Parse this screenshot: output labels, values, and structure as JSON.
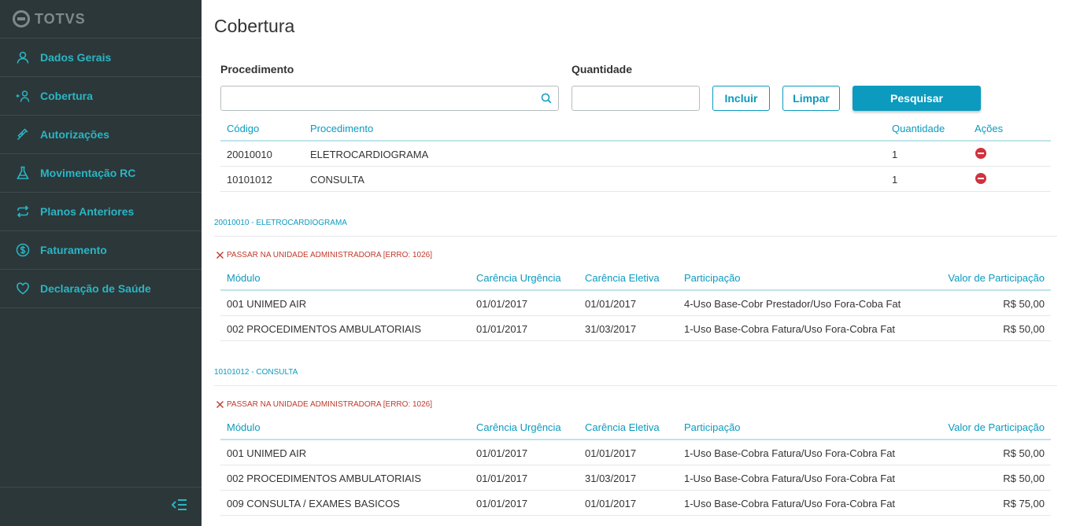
{
  "brand": {
    "name": "TOTVS",
    "accent": "#0c9abe",
    "sidebar_bg": "#2c3739",
    "error_color": "#c0392b"
  },
  "sidebar": {
    "items": [
      {
        "label": "Dados Gerais",
        "icon": "user-icon"
      },
      {
        "label": "Cobertura",
        "icon": "add-user-icon"
      },
      {
        "label": "Autorizações",
        "icon": "syringe-icon"
      },
      {
        "label": "Movimentação RC",
        "icon": "flask-icon"
      },
      {
        "label": "Planos Anteriores",
        "icon": "refresh-icon"
      },
      {
        "label": "Faturamento",
        "icon": "dollar-icon"
      },
      {
        "label": "Declaração de Saúde",
        "icon": "heart-icon"
      }
    ],
    "toggle_icon": "collapse-menu-icon"
  },
  "page": {
    "title": "Cobertura"
  },
  "form": {
    "procedimento_label": "Procedimento",
    "procedimento_value": "",
    "quantidade_label": "Quantidade",
    "quantidade_value": "",
    "incluir_label": "Incluir",
    "limpar_label": "Limpar",
    "pesquisar_label": "Pesquisar"
  },
  "procedures_table": {
    "headers": {
      "codigo": "Código",
      "procedimento": "Procedimento",
      "quantidade": "Quantidade",
      "acoes": "Ações"
    },
    "rows": [
      {
        "codigo": "20010010",
        "procedimento": "ELETROCARDIOGRAMA",
        "quantidade": "1",
        "action_icon": "remove-icon"
      },
      {
        "codigo": "10101012",
        "procedimento": "CONSULTA",
        "quantidade": "1",
        "action_icon": "remove-icon"
      }
    ]
  },
  "sections": [
    {
      "title": "20010010 - ELETROCARDIOGRAMA",
      "error": "PASSAR NA UNIDADE ADMINISTRADORA [ERRO: 1026]",
      "headers": {
        "modulo": "Módulo",
        "carencia_urgencia": "Carência Urgência",
        "carencia_eletiva": "Carência Eletiva",
        "participacao": "Participação",
        "valor": "Valor de Participação"
      },
      "rows": [
        {
          "modulo": "001 UNIMED AIR",
          "urgencia": "01/01/2017",
          "eletiva": "01/01/2017",
          "participacao": "4-Uso Base-Cobr Prestador/Uso Fora-Coba Fat",
          "valor": "R$ 50,00"
        },
        {
          "modulo": "002 PROCEDIMENTOS AMBULATORIAIS",
          "urgencia": "01/01/2017",
          "eletiva": "31/03/2017",
          "participacao": "1-Uso Base-Cobra Fatura/Uso Fora-Cobra Fat",
          "valor": "R$ 50,00"
        }
      ]
    },
    {
      "title": "10101012 - CONSULTA",
      "error": "PASSAR NA UNIDADE ADMINISTRADORA [ERRO: 1026]",
      "headers": {
        "modulo": "Módulo",
        "carencia_urgencia": "Carência Urgência",
        "carencia_eletiva": "Carência Eletiva",
        "participacao": "Participação",
        "valor": "Valor de Participação"
      },
      "rows": [
        {
          "modulo": "001 UNIMED AIR",
          "urgencia": "01/01/2017",
          "eletiva": "01/01/2017",
          "participacao": "1-Uso Base-Cobra Fatura/Uso Fora-Cobra Fat",
          "valor": "R$ 50,00"
        },
        {
          "modulo": "002 PROCEDIMENTOS AMBULATORIAIS",
          "urgencia": "01/01/2017",
          "eletiva": "31/03/2017",
          "participacao": "1-Uso Base-Cobra Fatura/Uso Fora-Cobra Fat",
          "valor": "R$ 50,00"
        },
        {
          "modulo": "009 CONSULTA / EXAMES BASICOS",
          "urgencia": "01/01/2017",
          "eletiva": "01/01/2017",
          "participacao": "1-Uso Base-Cobra Fatura/Uso Fora-Cobra Fat",
          "valor": "R$ 75,00"
        }
      ]
    }
  ]
}
